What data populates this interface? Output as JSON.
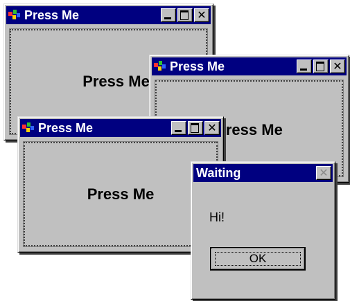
{
  "window_1": {
    "title": "Press Me",
    "content": "Press Me",
    "controls": {
      "minimize": "_",
      "maximize": "□",
      "close": "✕"
    },
    "icon": "app-icon"
  },
  "window_2": {
    "title": "Press Me",
    "content": "Press Me",
    "controls": {
      "minimize": "_",
      "maximize": "□",
      "close": "✕"
    },
    "icon": "app-icon"
  },
  "window_3": {
    "title": "Press Me",
    "content": "Press Me",
    "controls": {
      "minimize": "_",
      "maximize": "□",
      "close": "✕"
    },
    "icon": "app-icon"
  },
  "dialog": {
    "title": "Waiting",
    "message": "Hi!",
    "ok_label": "OK",
    "close_glyph": "✕",
    "close_enabled": false
  },
  "colors": {
    "title_bar": "#000080",
    "face": "#c0c0c0",
    "desktop": "#ffffff"
  }
}
